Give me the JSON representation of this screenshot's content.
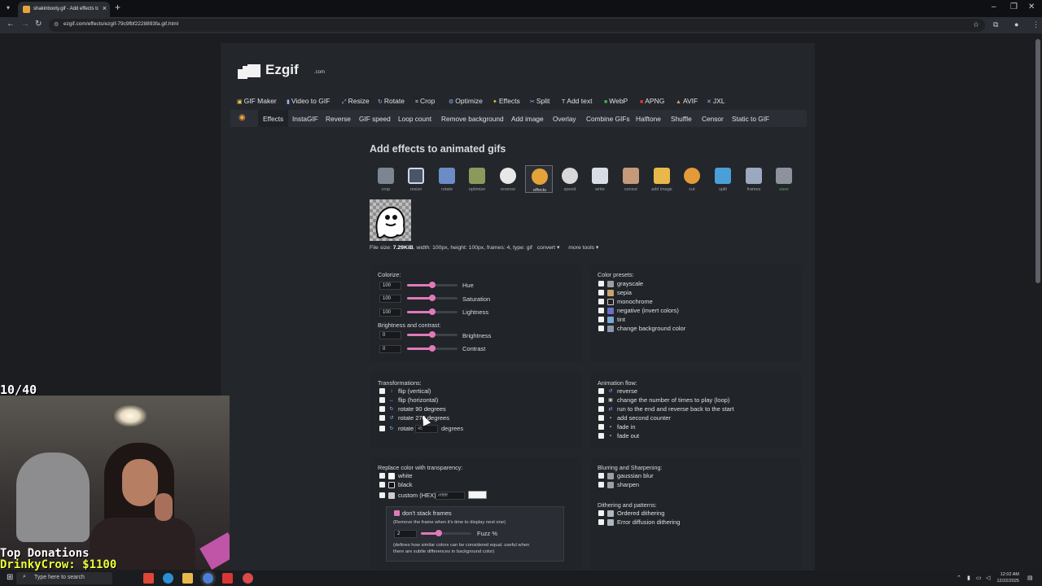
{
  "browser": {
    "tab_title": "shakinbooty.gif - Add effects to",
    "url": "ezgif.com/effects/ezgif-79c9fbf2228893fa.gif.html"
  },
  "site": {
    "logo": "Ezgif",
    "logo_suffix": ".com",
    "topnav": [
      "GIF Maker",
      "Video to GIF",
      "Resize",
      "Rotate",
      "Crop",
      "Optimize",
      "Effects",
      "Split",
      "Add text",
      "WebP",
      "APNG",
      "AVIF",
      "JXL"
    ],
    "subnav": [
      "Effects",
      "InstaGIF",
      "Reverse",
      "GIF speed",
      "Loop count",
      "Remove background",
      "Add image",
      "Overlay",
      "Combine GIFs",
      "Halftone",
      "Shuffle",
      "Censor",
      "Static to GIF"
    ],
    "heading": "Add effects to animated gifs",
    "tools": [
      "crop",
      "resize",
      "rotate",
      "optimize",
      "reverse",
      "effects",
      "speed",
      "write",
      "censor",
      "add image",
      "cut",
      "split",
      "frames",
      "save"
    ],
    "fileinfo": {
      "prefix": "File size: ",
      "size": "7.29KiB",
      "rest": ", width: 100px, height: 100px, frames: 4, type: gif",
      "convert": "convert ▾",
      "more": "more tools ▾"
    }
  },
  "colorize": {
    "title": "Colorize:",
    "hue_value": "100",
    "hue_label": "Hue",
    "sat_value": "100",
    "sat_label": "Saturation",
    "light_value": "100",
    "light_label": "Lightness",
    "levels": {
      "hue": 0.5,
      "saturation": 0.5,
      "lightness": 0.5
    }
  },
  "brightness": {
    "title": "Brightness and contrast:",
    "brightness_value": "0",
    "brightness_label": "Brightness",
    "contrast_value": "0",
    "contrast_label": "Contrast",
    "levels": {
      "brightness": 0.5,
      "contrast": 0.5
    }
  },
  "presets": {
    "title": "Color presets:",
    "items": [
      "grayscale",
      "sepia",
      "monochrome",
      "negative (invert colors)",
      "tint",
      "change background color"
    ]
  },
  "transform": {
    "title": "Transformations:",
    "items": [
      "flip (vertical)",
      "flip (horizontal)",
      "rotate 90 degrees",
      "rotate 270 degrees"
    ],
    "rotate_label": "rotate",
    "rotate_placeholder": "45",
    "degrees": "degrees"
  },
  "animation": {
    "title": "Animation flow:",
    "items": [
      "reverse",
      "change the number of times to play (loop)",
      "run to the end and reverse back to the start",
      "add second counter",
      "fade in",
      "fade out"
    ]
  },
  "replace": {
    "title": "Replace color with transparency:",
    "items": [
      "white",
      "black"
    ],
    "custom_label": "custom (HEX):",
    "hex_placeholder": "#ffffff",
    "dont_stack": "don't stack frames",
    "dont_stack_note": "(Remove the frame when it's time to display next one)",
    "fuzz_value": "2",
    "fuzz_label": "Fuzz %",
    "fuzz_level": 0.35,
    "fuzz_note1": "(defines how similar colors can be considered equal. useful when",
    "fuzz_note2": "there are subtle differences in background color)"
  },
  "blur": {
    "title": "Blurring and Sharpening:",
    "items": [
      "gaussian blur",
      "sharpen"
    ]
  },
  "dither": {
    "title": "Dithering and patterns:",
    "items": [
      "Ordered dithering",
      "Error diffusion dithering"
    ]
  },
  "overlay": {
    "counter": "10/40",
    "donations_title": "Top Donations",
    "donations_top": "DrinkyCrow: $1100"
  },
  "taskbar": {
    "search": "Type here to search",
    "time": "12:02 AM",
    "date": "12/22/2025"
  }
}
